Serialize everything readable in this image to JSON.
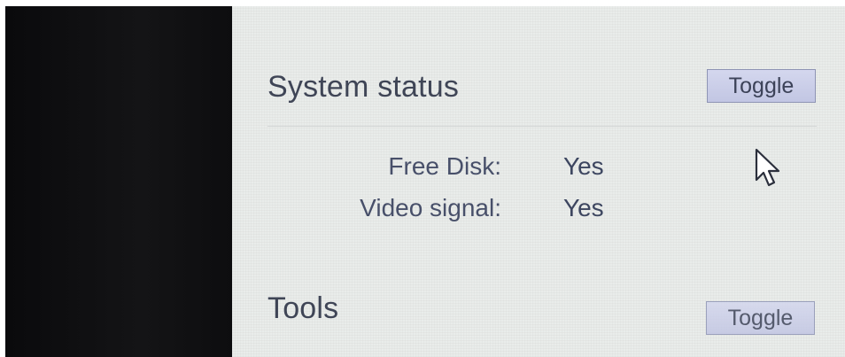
{
  "sections": {
    "system_status": {
      "title": "System status",
      "toggle_label": "Toggle",
      "rows": [
        {
          "label": "Free Disk:",
          "value": "Yes"
        },
        {
          "label": "Video signal:",
          "value": "Yes"
        }
      ]
    },
    "tools": {
      "title": "Tools",
      "toggle_label": "Toggle"
    }
  },
  "colors": {
    "screen_background": "#e9ecea",
    "text": "#3f4556",
    "button_fill": "#c8cbe6",
    "button_border": "#8e94b4",
    "bezel": "#0d0d0f"
  },
  "icons": {
    "pointer": "mouse-pointer-icon"
  }
}
